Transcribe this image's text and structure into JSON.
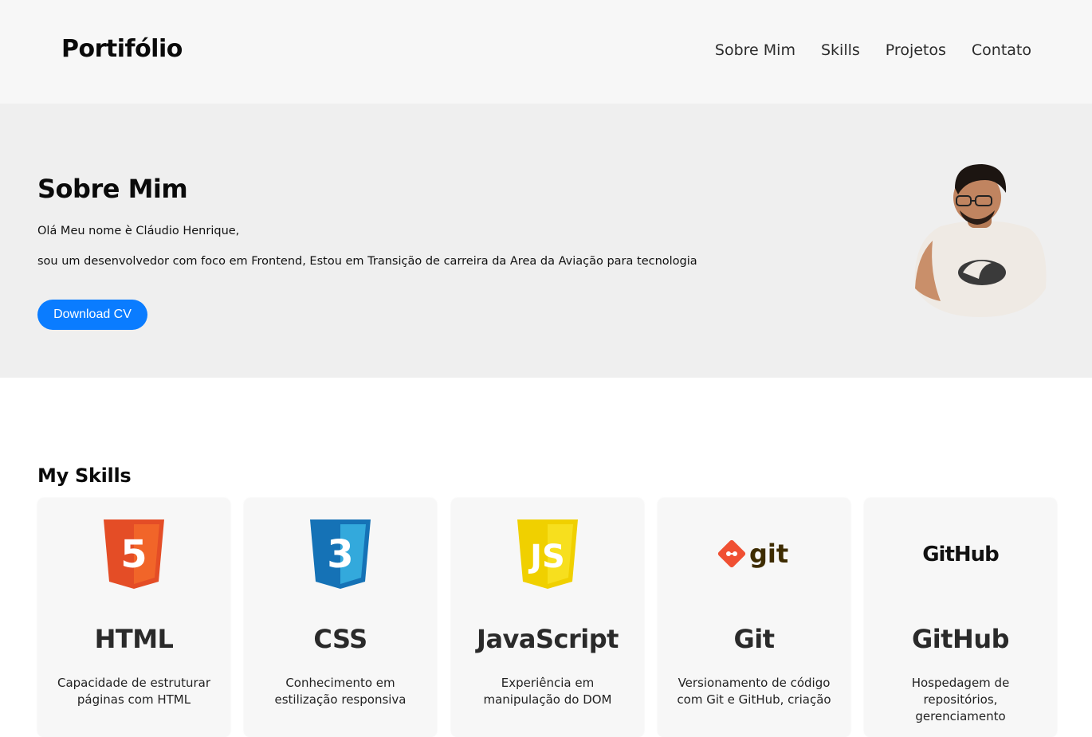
{
  "header": {
    "logo": "Portifólio",
    "nav": [
      "Sobre Mim",
      "Skills",
      "Projetos",
      "Contato"
    ]
  },
  "hero": {
    "title": "Sobre Mim",
    "line1": "Olá Meu nome è Cláudio Henrique,",
    "line2": "sou um desenvolvedor com foco em Frontend, Estou em Transição de carreira da Area da Aviação para tecnologia",
    "button": "Download CV"
  },
  "skills": {
    "title": "My Skills",
    "cards": [
      {
        "title": "HTML",
        "desc": "Capacidade de estruturar páginas com HTML",
        "icon": "html5-logo-icon",
        "logo_text": "5",
        "color": "#f05a28"
      },
      {
        "title": "CSS",
        "desc": "Conhecimento em estilização responsiva",
        "icon": "css3-logo-icon",
        "logo_text": "3",
        "color": "#1572b6"
      },
      {
        "title": "JavaScript",
        "desc": "Experiência em manipulação do DOM",
        "icon": "js-logo-icon",
        "logo_text": "JS",
        "color": "#f7d60a"
      },
      {
        "title": "Git",
        "desc": "Versionamento de código com Git e GitHub, criação",
        "icon": "git-logo-icon",
        "logo_text": "git",
        "color": "#f05033"
      },
      {
        "title": "GitHub",
        "desc": "Hospedagem de repositórios, gerenciamento",
        "icon": "github-logo-icon",
        "logo_text": "GitHub",
        "color": "#111111"
      }
    ]
  }
}
